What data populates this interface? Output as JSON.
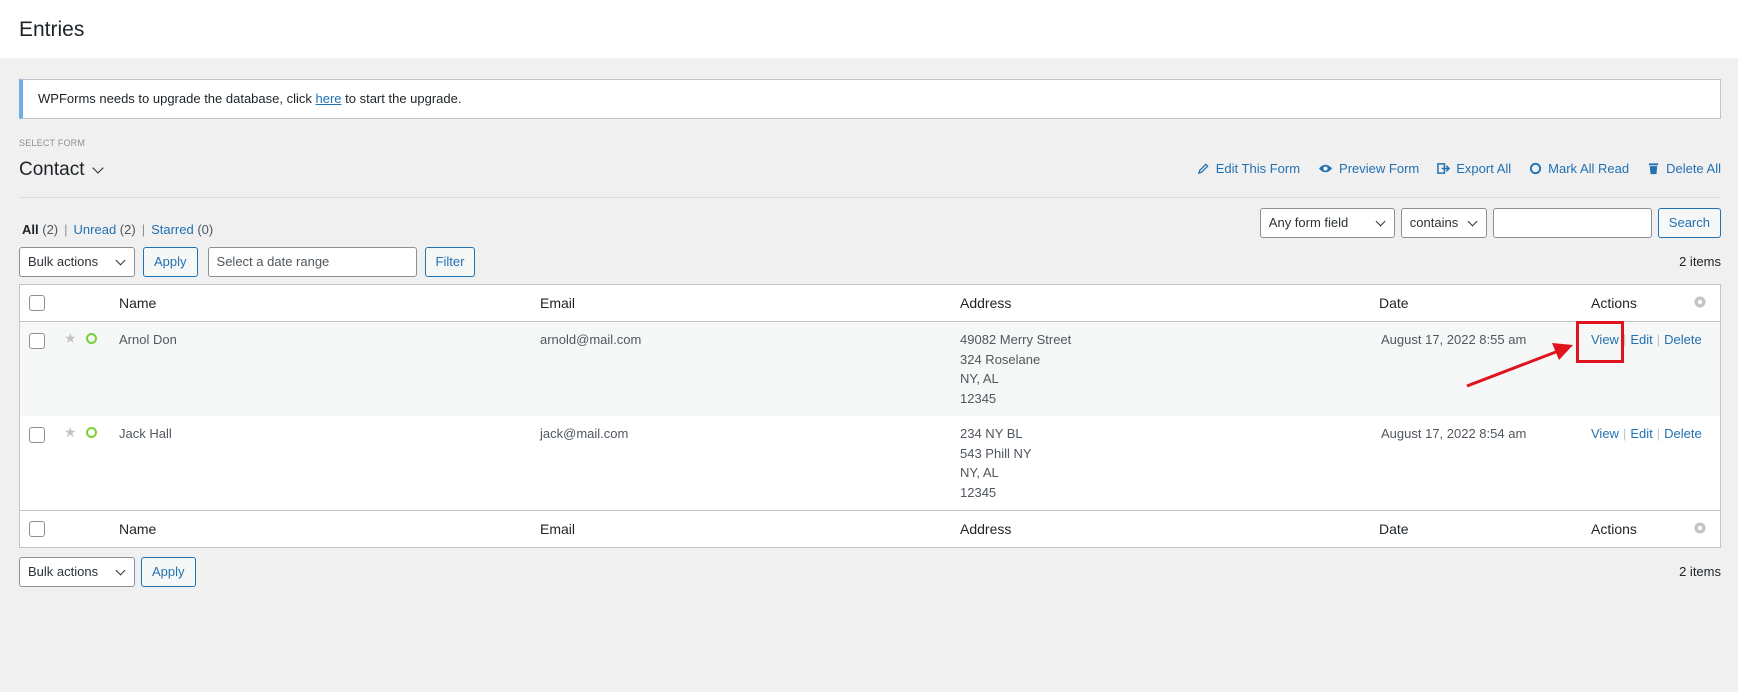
{
  "page": {
    "title": "Entries"
  },
  "notice": {
    "before": "WPForms needs to upgrade the database, click ",
    "link": "here",
    "after": " to start the upgrade."
  },
  "form_select": {
    "label": "SELECT FORM",
    "current": "Contact"
  },
  "form_actions": {
    "edit": "Edit This Form",
    "preview": "Preview Form",
    "export": "Export All",
    "mark_read": "Mark All Read",
    "delete_all": "Delete All"
  },
  "filters": {
    "all": "All",
    "all_count": "(2)",
    "unread": "Unread",
    "unread_count": "(2)",
    "starred": "Starred",
    "starred_count": "(0)"
  },
  "search": {
    "field": "Any form field",
    "operator": "contains",
    "value": "",
    "button": "Search"
  },
  "tablenav": {
    "bulk": "Bulk actions",
    "apply": "Apply",
    "date_placeholder": "Select a date range",
    "filter": "Filter",
    "items": "2 items"
  },
  "table": {
    "headers": {
      "name": "Name",
      "email": "Email",
      "address": "Address",
      "date": "Date",
      "actions": "Actions"
    },
    "rows": [
      {
        "name": "Arnol Don",
        "email": "arnold@mail.com",
        "address": [
          "49082 Merry Street",
          "324 Roselane",
          "NY, AL",
          "12345"
        ],
        "date": "August 17, 2022 8:55 am",
        "view": "View",
        "edit": "Edit",
        "delete": "Delete"
      },
      {
        "name": "Jack Hall",
        "email": "jack@mail.com",
        "address": [
          "234 NY BL",
          "543 Phill NY",
          "NY, AL",
          "12345"
        ],
        "date": "August 17, 2022 8:54 am",
        "view": "View",
        "edit": "Edit",
        "delete": "Delete"
      }
    ]
  },
  "colors": {
    "link": "#2271b1",
    "highlight": "#e0141e",
    "unread_ring": "#7ad03a"
  }
}
